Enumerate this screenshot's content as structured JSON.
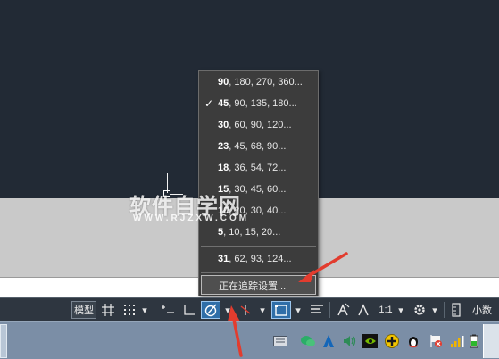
{
  "popup_menu": {
    "items": [
      {
        "lead": "90",
        "rest": ", 180, 270, 360...",
        "checked": false
      },
      {
        "lead": "45",
        "rest": ", 90, 135, 180...",
        "checked": true
      },
      {
        "lead": "30",
        "rest": ", 60, 90, 120...",
        "checked": false
      },
      {
        "lead": "23",
        "rest": ", 45, 68, 90...",
        "checked": false
      },
      {
        "lead": "18",
        "rest": ", 36, 54, 72...",
        "checked": false
      },
      {
        "lead": "15",
        "rest": ", 30, 45, 60...",
        "checked": false
      },
      {
        "lead": "10",
        "rest": ", 20, 30, 40...",
        "checked": false
      },
      {
        "lead": "5",
        "rest": ", 10, 15, 20...",
        "checked": false
      }
    ],
    "custom_item": {
      "lead": "31",
      "rest": ", 62, 93, 124..."
    },
    "tracking_settings": "正在追踪设置...",
    "check_glyph": "✓"
  },
  "watermark": {
    "title": "软件自学网",
    "subtitle": "WWW.RJZXW.COM"
  },
  "statusbar": {
    "model_label": "模型",
    "scale_label": "1:1",
    "decimal_label": "小数",
    "dropdown_glyph": "▾"
  },
  "colors": {
    "canvas_dark": "#222a35",
    "canvas_gray": "#c9c9c9",
    "menu_bg": "#3c3c3c",
    "active_button": "#2f6ea8",
    "arrow_red": "#e23c2e",
    "taskbar": "#7b8ea6"
  }
}
